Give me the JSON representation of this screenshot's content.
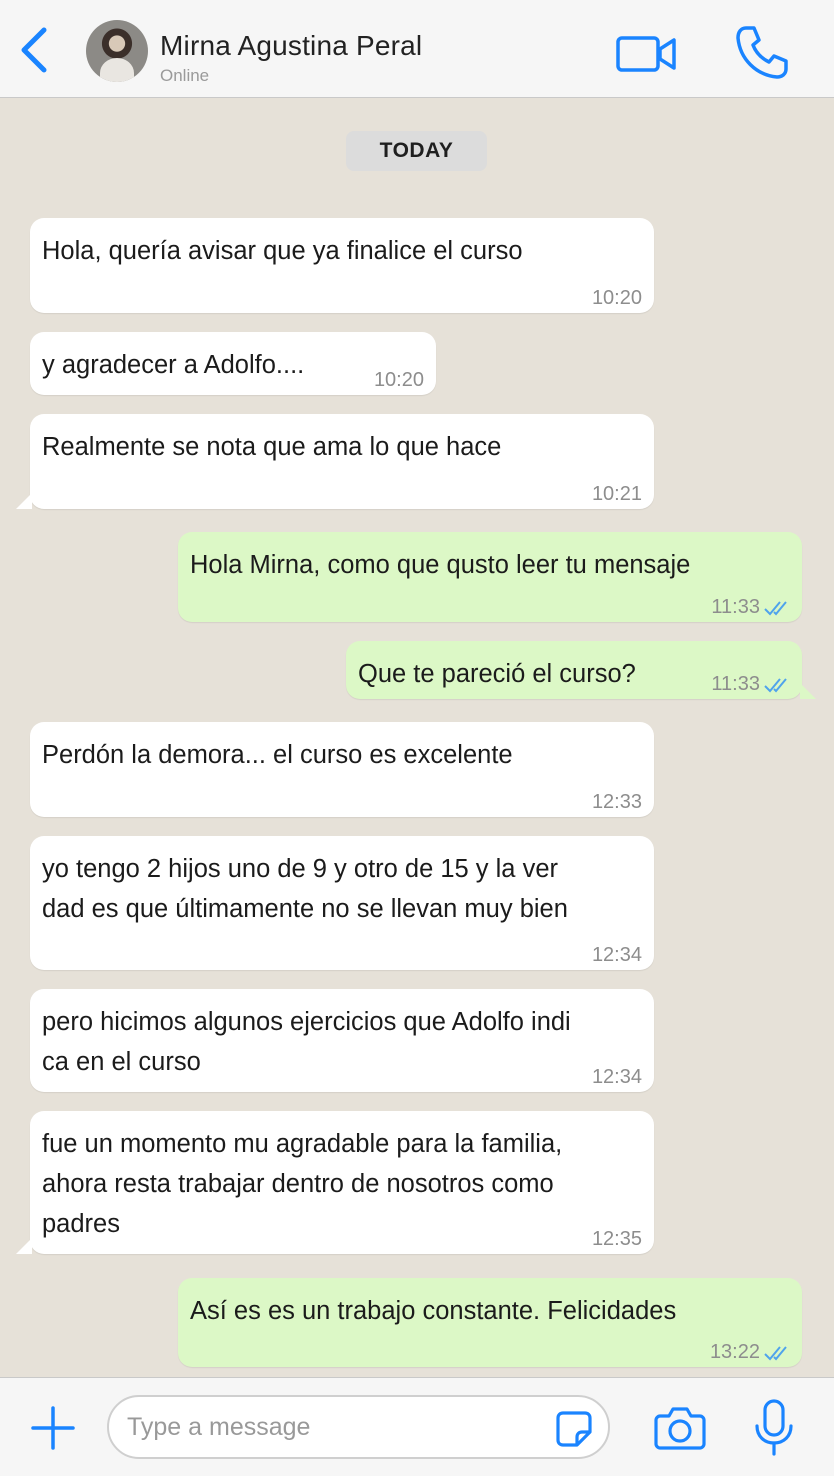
{
  "header": {
    "contact_name": "Mirna Agustina Peral",
    "status": "Online",
    "accent_color": "#1a84ff"
  },
  "chat": {
    "date_label": "TODAY",
    "messages": [
      {
        "direction": "in",
        "text": "Hola, quería avisar que ya finalice el curso",
        "time": "10:20"
      },
      {
        "direction": "in",
        "text": "y agradecer a Adolfo....",
        "time": "10:20"
      },
      {
        "direction": "in",
        "text": "Realmente se nota que ama lo que hace",
        "time": "10:21"
      },
      {
        "direction": "out",
        "text": "Hola Mirna, como que qusto leer tu mensaje",
        "time": "11:33",
        "status": "read"
      },
      {
        "direction": "out",
        "text": "Que te pareció el curso?",
        "time": "11:33",
        "status": "read"
      },
      {
        "direction": "in",
        "text": "Perdón la demora... el curso es excelente",
        "time": "12:33"
      },
      {
        "direction": "in",
        "text": "yo tengo 2 hijos uno de 9 y otro de 15 y la ver\ndad es que últimamente no se llevan muy bien",
        "time": "12:34"
      },
      {
        "direction": "in",
        "text": "pero hicimos algunos ejercicios que Adolfo indi\nca en el curso",
        "time": "12:34"
      },
      {
        "direction": "in",
        "text": "fue un momento mu agradable para la familia,\nahora resta trabajar dentro de nosotros como\npadres",
        "time": "12:35"
      },
      {
        "direction": "out",
        "text": "Así es es un trabajo constante. Felicidades",
        "time": "13:22",
        "status": "read"
      }
    ]
  },
  "composer": {
    "placeholder": "Type a message"
  },
  "colors": {
    "incoming_bubble": "#ffffff",
    "outgoing_bubble": "#dcf8c6",
    "chat_background": "#e6e1d8",
    "read_ticks": "#4fa3ec"
  }
}
